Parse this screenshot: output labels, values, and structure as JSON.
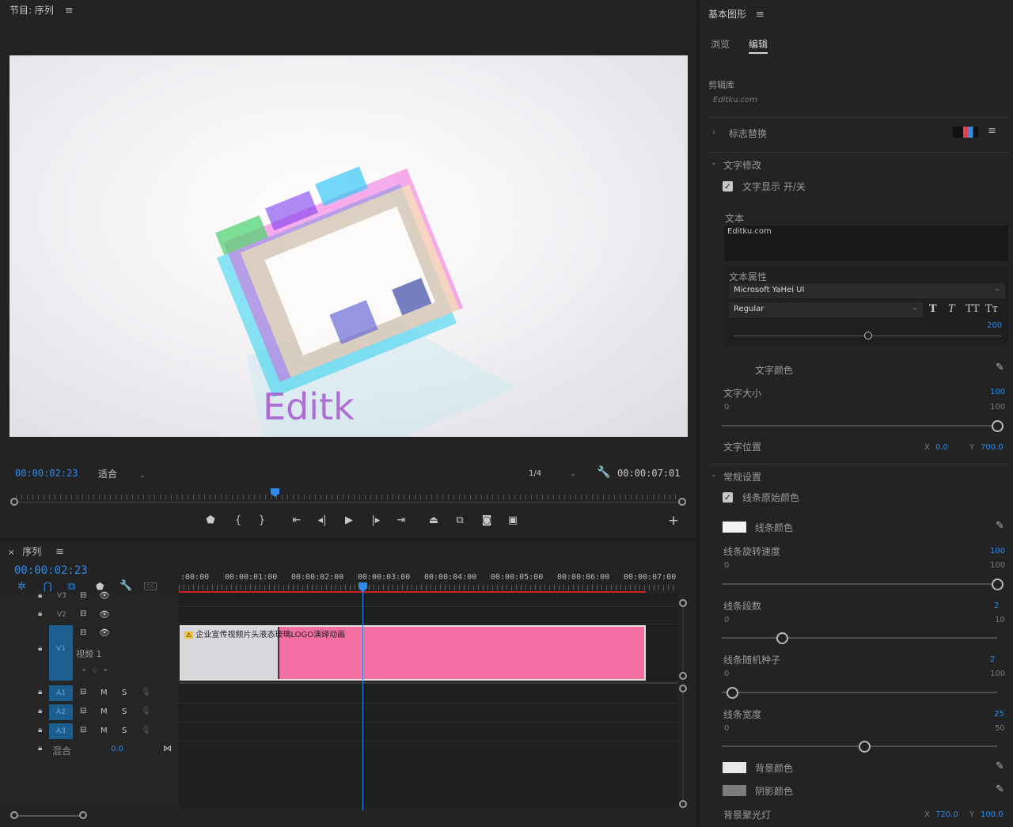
{
  "program": {
    "title": "节目: 序列",
    "timecode": "00:00:02:23",
    "fit": "适合",
    "resolution": "1/4",
    "duration": "00:00:07:01",
    "video_text": "Editk"
  },
  "sequence": {
    "tab": "序列",
    "timecode": "00:00:02:23",
    "ruler": [
      ":00:00",
      "00:00:01:00",
      "00:00:02:00",
      "00:00:03:00",
      "00:00:04:00",
      "00:00:05:00",
      "00:00:06:00",
      "00:00:07:00"
    ],
    "tracks": {
      "v3": "V3",
      "v2": "V2",
      "v1": "V1",
      "v1_name": "视频 1",
      "a1": "A1",
      "a2": "A2",
      "a3": "A3",
      "mute": "M",
      "solo": "S",
      "mix": "混合",
      "mix_value": "0.0"
    },
    "clip_label": "企业宣传视频片头液态玻璃LOGO演绎动画"
  },
  "graphics": {
    "title": "基本图形",
    "tabs": [
      "浏览",
      "编辑"
    ],
    "library": "剪辑库",
    "library_sub": "Editku.com",
    "logo_replace": "标志替换",
    "text_section": "文字修改",
    "text_toggle": "文字显示 开/关",
    "text_label": "文本",
    "text_value": "Editku.com",
    "text_props": "文本属性",
    "font": "Microsoft YaHei UI",
    "style": "Regular",
    "font_size": "200",
    "text_color": "文字颜色",
    "text_size": "文字大小",
    "text_size_val": "100",
    "text_size_min": "0",
    "text_size_max": "100",
    "text_pos": "文字位置",
    "text_pos_x_lbl": "X",
    "text_pos_x": "0.0",
    "text_pos_y_lbl": "Y",
    "text_pos_y": "700.0",
    "general": "常规设置",
    "line_orig_color": "线条原始颜色",
    "line_color": "线条颜色",
    "line_speed": "线条旋转速度",
    "line_speed_val": "100",
    "line_speed_min": "0",
    "line_speed_max": "100",
    "line_segments": "线条段数",
    "line_segments_val": "2",
    "line_segments_min": "0",
    "line_segments_max": "10",
    "line_seed": "线条随机种子",
    "line_seed_val": "2",
    "line_seed_min": "0",
    "line_seed_max": "100",
    "line_width": "线条宽度",
    "line_width_val": "25",
    "line_width_min": "0",
    "line_width_max": "50",
    "bg_color": "背景颜色",
    "shadow_color": "阴影颜色",
    "bg_spot": "背景聚光灯",
    "bg_spot_x_lbl": "X",
    "bg_spot_x": "720.0",
    "bg_spot_y_lbl": "Y",
    "bg_spot_y": "100.0"
  },
  "colors": {
    "accent": "#2d8ceb",
    "clip": "#f46fa4",
    "line_color_swatch": "#f2f2f2",
    "bg_color_swatch": "#e8e8e8",
    "shadow_color_swatch": "#7c7c7c"
  }
}
